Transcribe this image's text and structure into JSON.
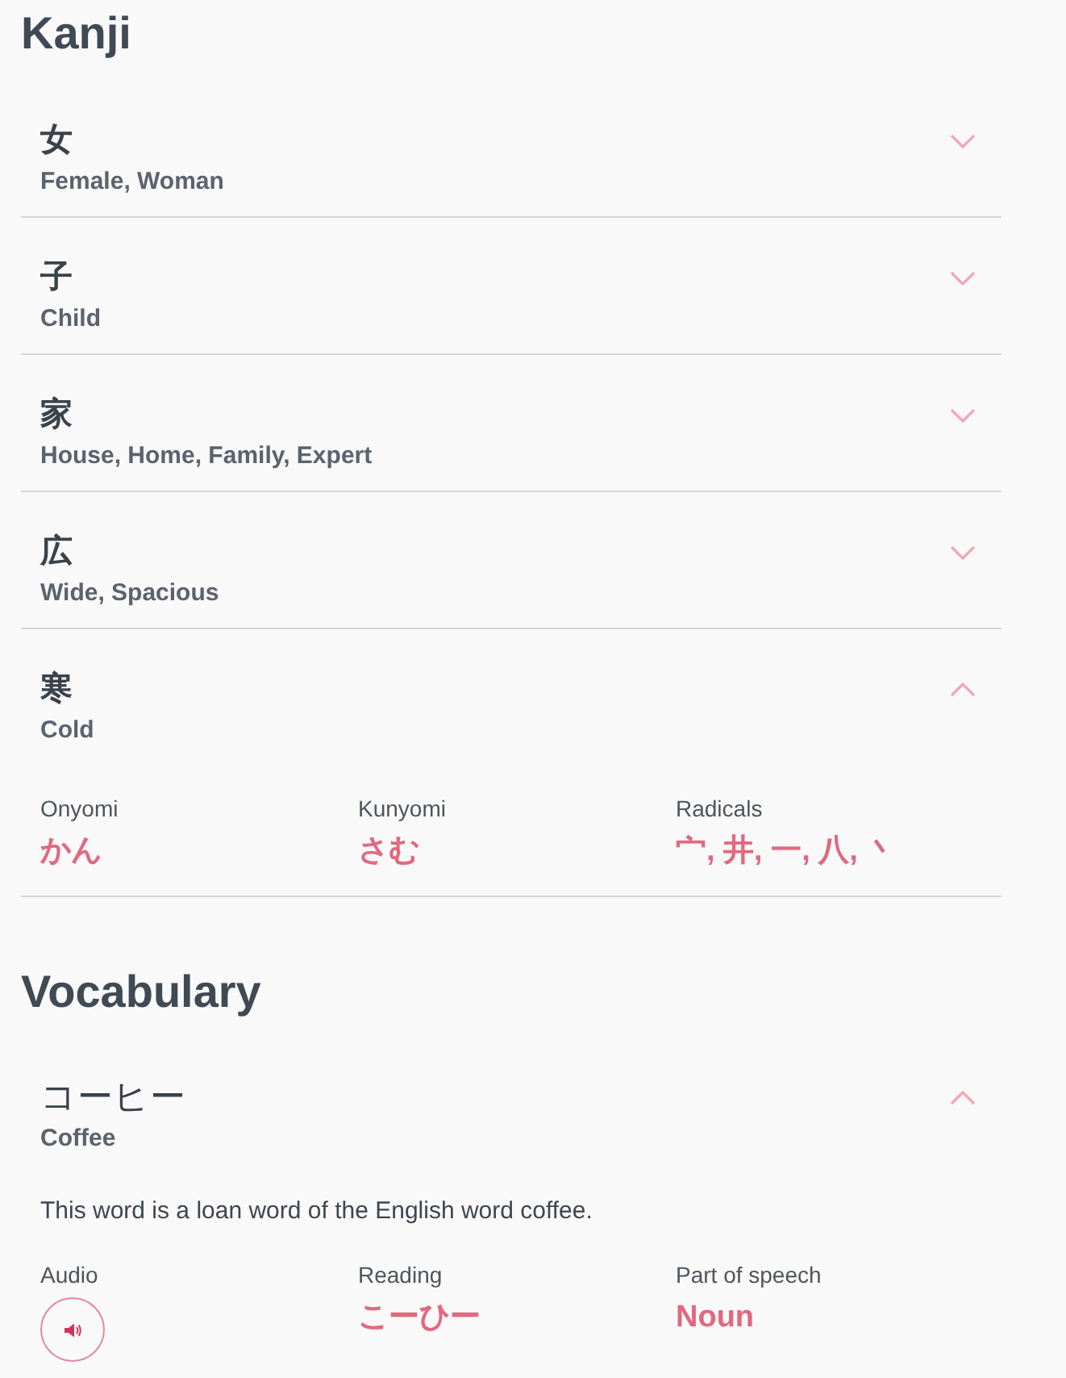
{
  "kanji": {
    "title": "Kanji",
    "items": [
      {
        "character": "女",
        "meaning": "Female, Woman",
        "expanded": false
      },
      {
        "character": "子",
        "meaning": "Child",
        "expanded": false
      },
      {
        "character": "家",
        "meaning": "House, Home, Family, Expert",
        "expanded": false
      },
      {
        "character": "広",
        "meaning": "Wide, Spacious",
        "expanded": false
      },
      {
        "character": "寒",
        "meaning": "Cold",
        "expanded": true,
        "details": [
          {
            "label": "Onyomi",
            "value": "かん"
          },
          {
            "label": "Kunyomi",
            "value": "さむ"
          },
          {
            "label": "Radicals",
            "value": "宀, 井, 一, 八, 丶"
          }
        ]
      }
    ]
  },
  "vocabulary": {
    "title": "Vocabulary",
    "items": [
      {
        "word": "コーヒー",
        "meaning": "Coffee",
        "expanded": true,
        "description": "This word is a loan word of the English word coffee.",
        "details": [
          {
            "kind": "audio",
            "label": "Audio"
          },
          {
            "kind": "text",
            "label": "Reading",
            "value": "こーひー"
          },
          {
            "kind": "text",
            "label": "Part of speech",
            "value": "Noun"
          }
        ]
      }
    ]
  }
}
